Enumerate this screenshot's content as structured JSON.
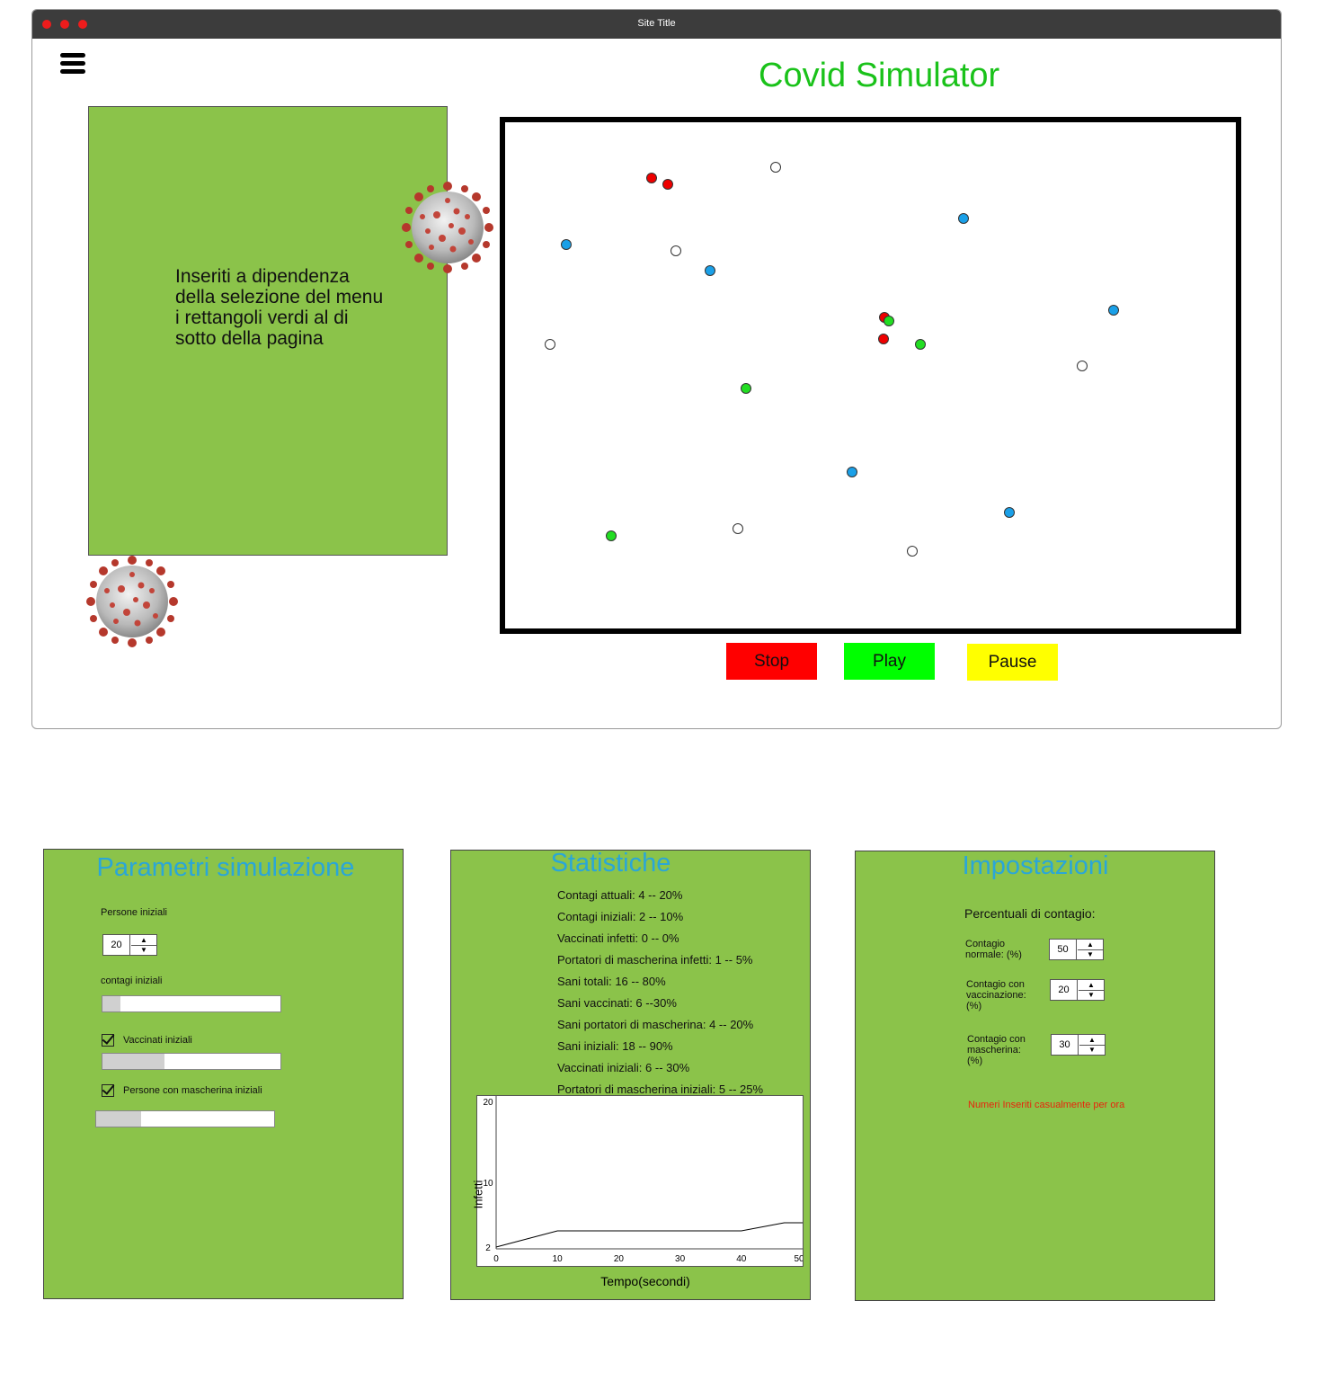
{
  "window": {
    "title": "Site Title"
  },
  "header": {
    "menu_icon": "hamburger-menu-icon",
    "app_title": "Covid Simulator"
  },
  "info_panel": {
    "text": "Inseriti a dipendenza della selezione del menu i rettangoli verdi al di sotto della pagina"
  },
  "decor": {
    "virus_icon": "coronavirus-icon"
  },
  "legend_colors": {
    "infected": "#ee0000",
    "healthy": "#ffffff",
    "vaccinated": "#1aa0e8",
    "masked": "#22dd22"
  },
  "controls": {
    "stop": {
      "label": "Stop",
      "color": "#ff0000"
    },
    "play": {
      "label": "Play",
      "color": "#00ff00"
    },
    "pause": {
      "label": "Pause",
      "color": "#ffff00"
    }
  },
  "parametri": {
    "title": "Parametri simulazione",
    "persone_label": "Persone iniziali",
    "persone_value": "20",
    "contagi_label": "contagi iniziali",
    "contagi_level": 0.1,
    "vaccinati_label": "Vaccinati iniziali",
    "vaccinati_checked": true,
    "vaccinati_level": 0.35,
    "mascherina_label": "Persone con mascherina iniziali",
    "mascherina_checked": true,
    "mascherina_level": 0.25
  },
  "statistiche": {
    "title": "Statistiche",
    "lines": [
      "Contagi attuali: 4 -- 20%",
      "Contagi iniziali: 2 -- 10%",
      "Vaccinati infetti: 0 -- 0%",
      "Portatori di mascherina infetti: 1 -- 5%",
      "Sani totali: 16 -- 80%",
      "Sani vaccinati: 6 --30%",
      "Sani portatori di mascherina: 4 -- 20%",
      "Sani iniziali: 18 -- 90%",
      "Vaccinati iniziali: 6 -- 30%",
      "Portatori di mascherina iniziali: 5 -- 25%"
    ]
  },
  "chart_data": {
    "type": "line",
    "title": "",
    "xlabel": "Tempo(secondi)",
    "ylabel": "Infetti",
    "xlim": [
      0,
      50
    ],
    "ylim": [
      2,
      20
    ],
    "x_ticks": [
      "0",
      "10",
      "20",
      "30",
      "40",
      "50"
    ],
    "y_ticks": [
      "20",
      "10",
      "2"
    ],
    "grid": false,
    "series": [
      {
        "x": [
          0,
          10,
          20,
          30,
          40,
          47,
          50
        ],
        "y": [
          2,
          4,
          4,
          4,
          4,
          5,
          5
        ]
      }
    ]
  },
  "impostazioni": {
    "title": "Impostazioni",
    "heading": "Percentuali di contagio:",
    "fields": [
      {
        "label": "Contagio normale: (%)",
        "value": "50"
      },
      {
        "label": "Contagio con vaccinazione: (%)",
        "value": "20"
      },
      {
        "label": "Contagio con mascherina: (%)",
        "value": "30"
      }
    ],
    "note": "Numeri Inseriti casualmente per ora",
    "note_color": "#e8240c"
  }
}
